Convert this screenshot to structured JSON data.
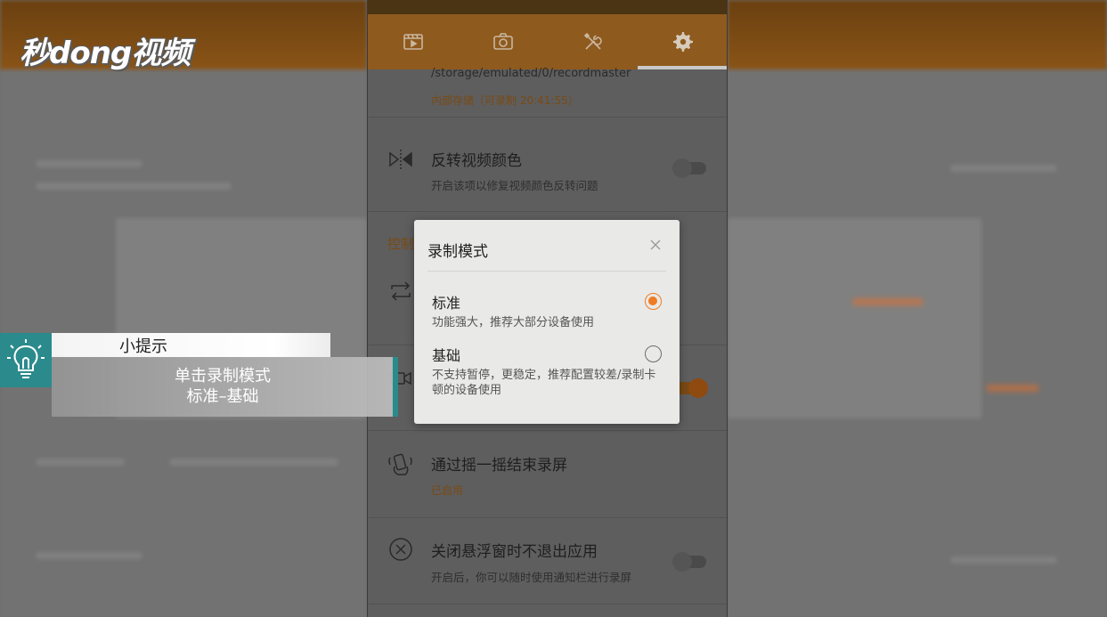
{
  "brand": {
    "logo_text": "秒dong视频"
  },
  "phone": {
    "tabs": [
      {
        "icon": "video-library-icon"
      },
      {
        "icon": "camera-icon"
      },
      {
        "icon": "tools-icon"
      },
      {
        "icon": "gear-icon",
        "active": true
      }
    ],
    "storage": {
      "path": "/storage/emulated/0/recordmaster",
      "info": "内部存储（可录制 20:41:55）"
    },
    "invert_colors": {
      "title": "反转视频颜色",
      "subtitle": "开启该项以修复视频颜色反转问题",
      "enabled": false
    },
    "control_section_label": "控制",
    "shake_to_stop": {
      "title": "通过摇一摇结束录屏",
      "status": "已启用"
    },
    "close_floating": {
      "title": "关闭悬浮窗时不退出应用",
      "subtitle": "开启后，你可以随时使用通知栏进行录屏",
      "enabled": false
    }
  },
  "dialog": {
    "title": "录制模式",
    "options": [
      {
        "label": "标准",
        "description": "功能强大，推荐大部分设备使用",
        "selected": true
      },
      {
        "label": "基础",
        "description": "不支持暂停，更稳定，推荐配置较差/录制卡顿的设备使用",
        "selected": false
      }
    ]
  },
  "tip": {
    "heading": "小提示",
    "line1": "单击录制模式",
    "line2": "标准–基础"
  },
  "colors": {
    "accent": "#ef7c22",
    "tip_teal": "#2b8a8c",
    "topbar": "#8f5a1e"
  }
}
